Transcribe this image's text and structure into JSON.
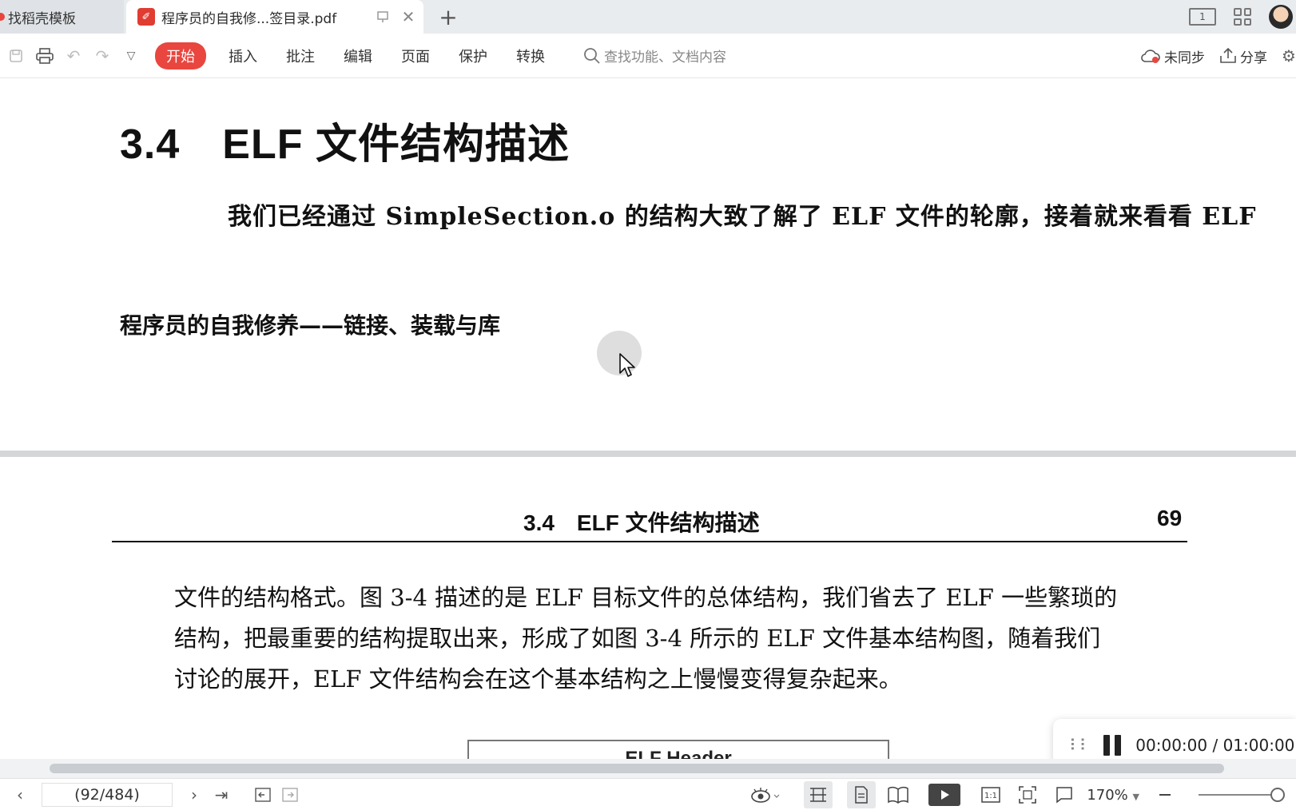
{
  "tabs": [
    {
      "label": "找稻壳模板",
      "active": false
    },
    {
      "label": "程序员的自我修...签目录.pdf",
      "active": true
    }
  ],
  "window": {
    "layout_badge": "1"
  },
  "toolbar": {
    "menu": [
      "开始",
      "插入",
      "批注",
      "编辑",
      "页面",
      "保护",
      "转换"
    ],
    "active_menu": "开始",
    "search_placeholder": "查找功能、文档内容",
    "sync_label": "未同步",
    "share_label": "分享"
  },
  "document": {
    "page1": {
      "heading": "3.4　ELF 文件结构描述",
      "paragraph": "我们已经通过 SimpleSection.o 的结构大致了解了 ELF 文件的轮廓，接着就来看看 ELF",
      "footer_title": "程序员的自我修养——链接、装载与库"
    },
    "page2": {
      "running_head": "3.4　ELF 文件结构描述",
      "page_number": "69",
      "lines": [
        "文件的结构格式。图 3-4 描述的是 ELF 目标文件的总体结构，我们省去了 ELF 一些繁琐的",
        "结构，把最重要的结构提取出来，形成了如图 3-4 所示的 ELF 文件基本结构图，随着我们",
        "讨论的展开，ELF 文件结构会在这个基本结构之上慢慢变得复杂起来。"
      ],
      "figure_label": "ELF Header"
    }
  },
  "media": {
    "time": "00:00:00 / 01:00:00"
  },
  "statusbar": {
    "page_indicator": "(92/484)",
    "zoom": "170%",
    "zoom_fraction": 1.0
  },
  "colors": {
    "accent": "#e9463f",
    "pdf_icon": "#e03c31"
  }
}
